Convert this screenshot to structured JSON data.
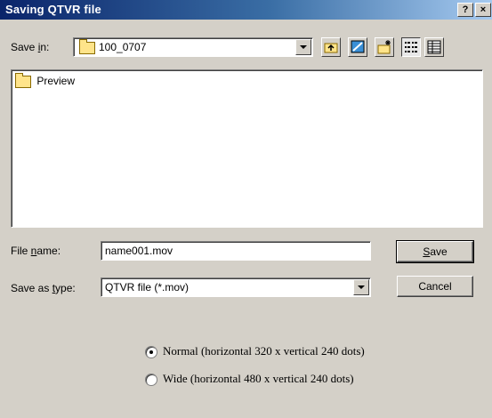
{
  "window": {
    "title": "Saving QTVR file",
    "help_label": "?",
    "close_label": "×"
  },
  "save_in": {
    "label_pre": "Save ",
    "label_u": "i",
    "label_post": "n:",
    "value": "100_0707"
  },
  "toolbar": {
    "icons": [
      "up-folder-icon",
      "desktop-icon",
      "new-folder-icon",
      "list-view-icon",
      "details-view-icon"
    ]
  },
  "file_list": {
    "items": [
      "Preview"
    ]
  },
  "file_name": {
    "label_pre": "File ",
    "label_u": "n",
    "label_post": "ame:",
    "value": "name001.mov"
  },
  "save_as_type": {
    "label_pre": "Save as ",
    "label_u": "t",
    "label_post": "ype:",
    "value": "QTVR file (*.mov)"
  },
  "buttons": {
    "save_u": "S",
    "save_rest": "ave",
    "cancel": "Cancel"
  },
  "options": [
    {
      "label": "Normal (horizontal 320 x vertical 240 dots)",
      "checked": true
    },
    {
      "label": "Wide (horizontal 480 x vertical 240 dots)",
      "checked": false
    }
  ]
}
